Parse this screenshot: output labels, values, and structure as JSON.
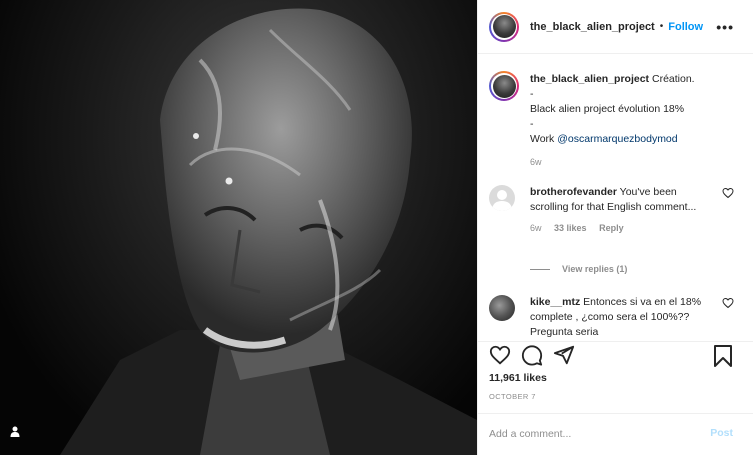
{
  "header": {
    "username": "the_black_alien_project",
    "separator": "•",
    "follow_label": "Follow",
    "more_label": "•••"
  },
  "caption": {
    "username": "the_black_alien_project",
    "text_line1": "Création.",
    "text_line2": "-",
    "text_line3": "Black alien project évolution 18%",
    "text_line4": "-",
    "text_line5": "Work ",
    "mention": "@oscarmarquezbodymod",
    "age": "6w"
  },
  "comments": [
    {
      "username": "brotherofevander",
      "text": "You've been scrolling for that English comment...",
      "age": "6w",
      "likes": "33 likes",
      "reply_label": "Reply",
      "view_replies": "View replies (1)"
    },
    {
      "username": "kike__mtz",
      "text": "Entonces si va en el 18% complete , ¿como sera el 100%?? Pregunta seria"
    }
  ],
  "stats": {
    "likes": "11,961 likes",
    "date": "OCTOBER 7"
  },
  "comment_box": {
    "placeholder": "Add a comment...",
    "post_label": "Post"
  },
  "icons": {
    "like": "heart-icon",
    "comment": "comment-icon",
    "share": "paper-plane-icon",
    "save": "bookmark-icon",
    "tag": "user-tag-icon",
    "more": "ellipsis-icon"
  },
  "colors": {
    "link": "#0095f6",
    "mention": "#00376b",
    "muted": "#8e8e8e",
    "post_disabled": "#b2dffc"
  }
}
